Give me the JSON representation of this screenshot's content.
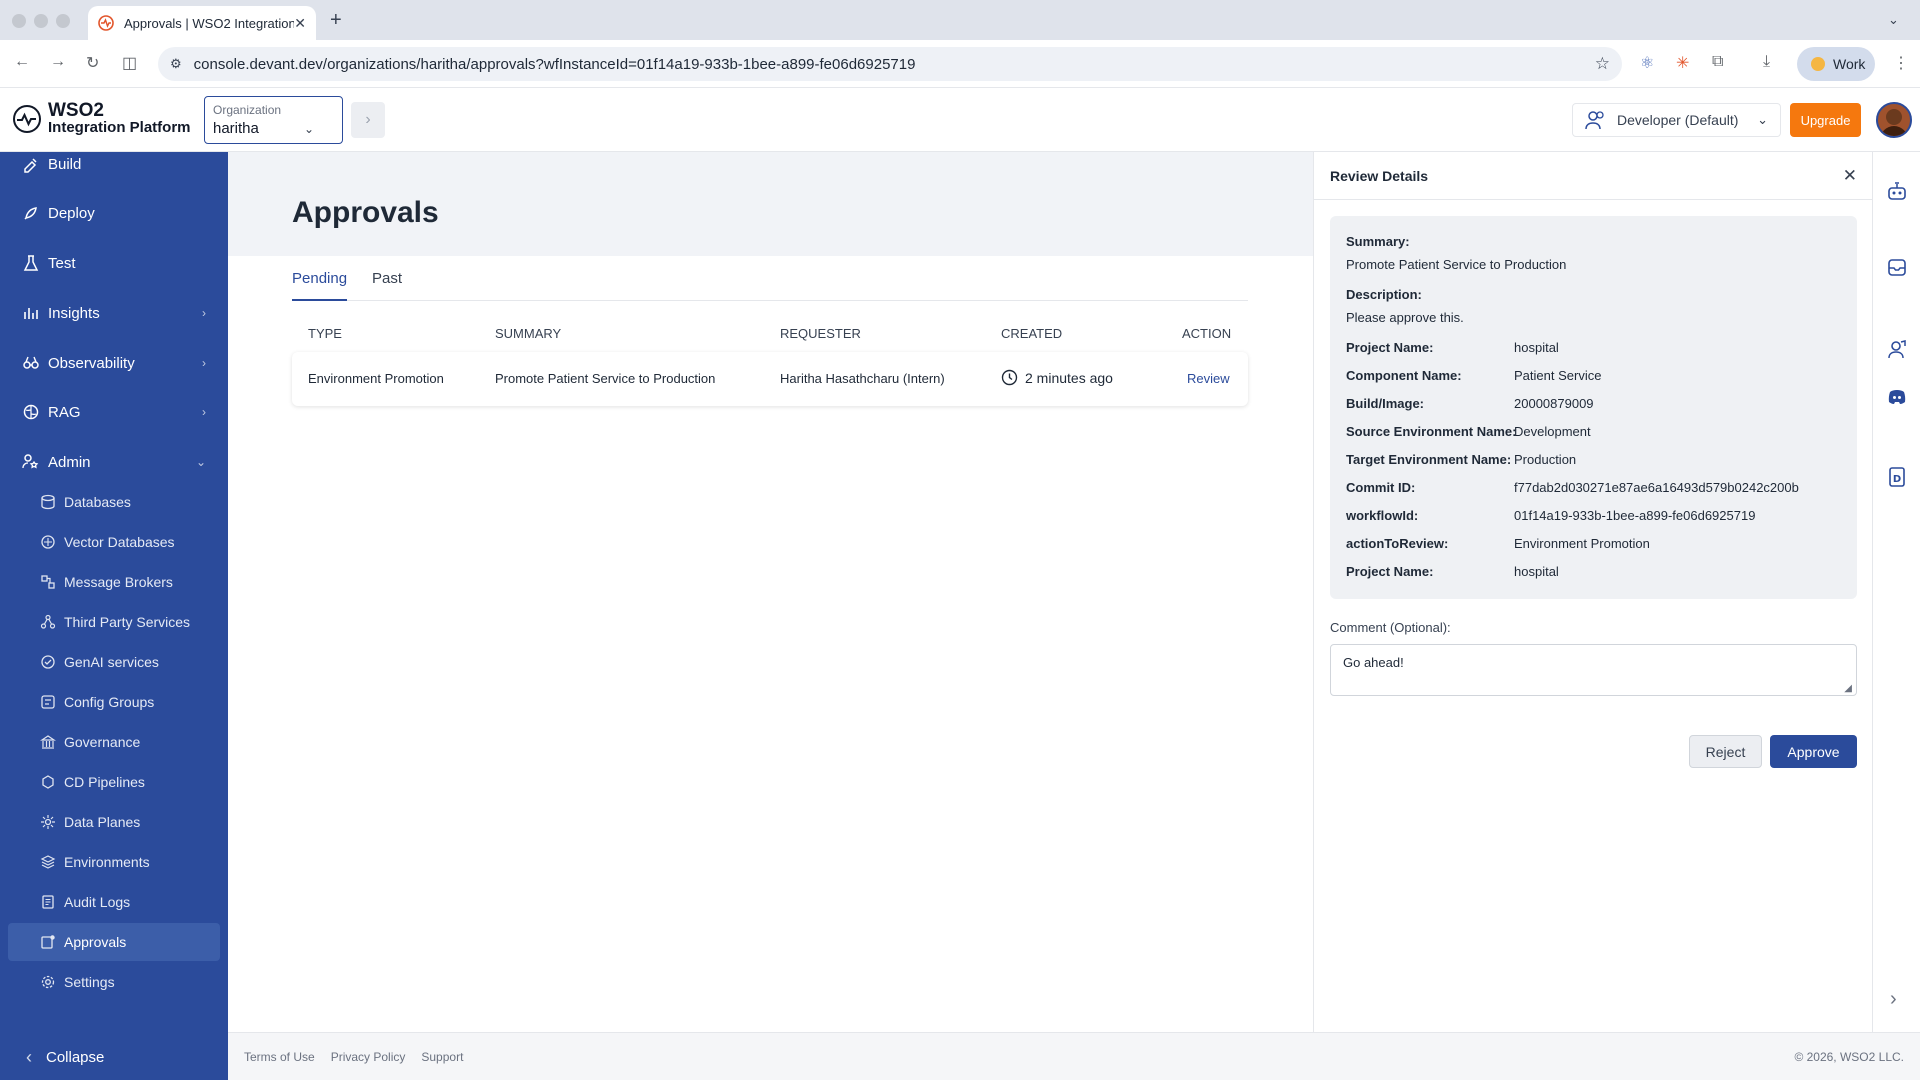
{
  "browser": {
    "tab_title": "Approvals | WSO2 Integration Platform",
    "url": "console.devant.dev/organizations/haritha/approvals?wfInstanceId=01f14a19-933b-1bee-a899-fe06d6925719",
    "profile_label": "Work"
  },
  "header": {
    "logo_line1": "WSO2",
    "logo_line2": "Integration Platform",
    "org_label": "Organization",
    "org_value": "haritha",
    "role": "Developer (Default)",
    "upgrade_label": "Upgrade"
  },
  "sidebar": {
    "items": [
      {
        "label": "Build",
        "icon": "build-icon"
      },
      {
        "label": "Deploy",
        "icon": "rocket-icon"
      },
      {
        "label": "Test",
        "icon": "flask-icon"
      },
      {
        "label": "Insights",
        "icon": "bar-chart-icon"
      },
      {
        "label": "Observability",
        "icon": "binoculars-icon"
      },
      {
        "label": "RAG",
        "icon": "brain-icon"
      },
      {
        "label": "Admin",
        "icon": "admin-icon"
      }
    ],
    "admin_items": [
      {
        "label": "Databases"
      },
      {
        "label": "Vector Databases"
      },
      {
        "label": "Message Brokers"
      },
      {
        "label": "Third Party Services"
      },
      {
        "label": "GenAI services"
      },
      {
        "label": "Config Groups"
      },
      {
        "label": "Governance"
      },
      {
        "label": "CD Pipelines"
      },
      {
        "label": "Data Planes"
      },
      {
        "label": "Environments"
      },
      {
        "label": "Audit Logs"
      },
      {
        "label": "Approvals"
      },
      {
        "label": "Settings"
      }
    ],
    "collapse_label": "Collapse"
  },
  "main": {
    "title": "Approvals",
    "tabs": [
      "Pending",
      "Past"
    ],
    "columns": [
      "TYPE",
      "SUMMARY",
      "REQUESTER",
      "CREATED",
      "ACTION"
    ],
    "rows": [
      {
        "type": "Environment Promotion",
        "summary": "Promote Patient Service to Production",
        "requester": "Haritha Hasathcharu (Intern)",
        "created": "2 minutes ago",
        "action": "Review"
      }
    ]
  },
  "review": {
    "title": "Review Details",
    "summary_label": "Summary:",
    "summary_value": "Promote Patient Service to Production",
    "description_label": "Description:",
    "description_value": "Please approve this.",
    "fields": [
      {
        "key": "Project Name:",
        "value": "hospital"
      },
      {
        "key": "Component Name:",
        "value": "Patient Service"
      },
      {
        "key": "Build/Image:",
        "value": "20000879009"
      },
      {
        "key": "Source Environment Name:",
        "value": "Development"
      },
      {
        "key": "Target Environment Name:",
        "value": "Production"
      },
      {
        "key": "Commit ID:",
        "value": "f77dab2d030271e87ae6a16493d579b0242c200b"
      },
      {
        "key": "workflowId:",
        "value": "01f14a19-933b-1bee-a899-fe06d6925719"
      },
      {
        "key": "actionToReview:",
        "value": "Environment Promotion"
      },
      {
        "key": "Project Name:",
        "value": "hospital"
      }
    ],
    "comment_label": "Comment (Optional):",
    "comment_value": "Go ahead!",
    "reject_label": "Reject",
    "approve_label": "Approve"
  },
  "footer": {
    "links": [
      "Terms of Use",
      "Privacy Policy",
      "Support"
    ],
    "copyright": "© 2026, WSO2 LLC."
  },
  "colors": {
    "brand": "#2b4b9b",
    "upgrade": "#f5780e"
  }
}
